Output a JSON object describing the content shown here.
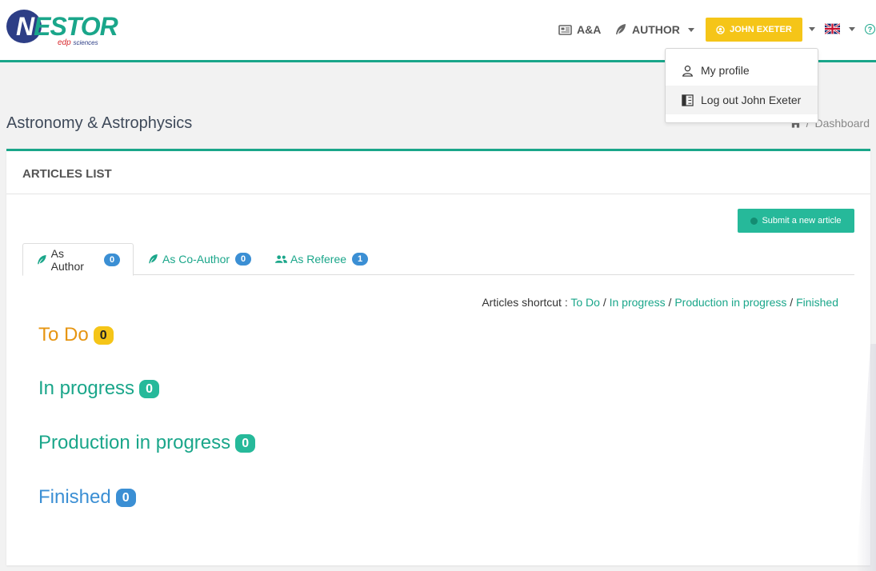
{
  "header": {
    "logo_main": "N",
    "logo_rest": "ESTOR",
    "logo_edp": "edp",
    "logo_sciences": "sciences",
    "journal_link": "A&A",
    "author_menu": "AUTHOR",
    "user_button": "JOHN EXETER"
  },
  "user_menu": {
    "items": [
      {
        "label": "My profile",
        "icon": "user-icon"
      },
      {
        "label": "Log out John Exeter",
        "icon": "logout-icon"
      }
    ]
  },
  "page": {
    "title": "Astronomy & Astrophysics",
    "breadcrumb_separator": "/",
    "breadcrumb_current": "Dashboard"
  },
  "panel": {
    "title": "ARTICLES LIST",
    "submit_label": "Submit a new article",
    "tabs": [
      {
        "label": "As Author",
        "count": "0",
        "active": true
      },
      {
        "label": "As Co-Author",
        "count": "0",
        "active": false
      },
      {
        "label": "As Referee",
        "count": "1",
        "active": false
      }
    ],
    "shortcut": {
      "prefix": "Articles shortcut : ",
      "links": [
        "To Do",
        "In progress",
        "Production in progress",
        "Finished"
      ],
      "separator": " / "
    },
    "sections": [
      {
        "label": "To Do",
        "count": "0",
        "color": "#e69512"
      },
      {
        "label": "In progress",
        "count": "0",
        "color": "#1aa68a"
      },
      {
        "label": "Production in progress",
        "count": "0",
        "color": "#1aa68a"
      },
      {
        "label": "Finished",
        "count": "0",
        "color": "#3b8fd4"
      }
    ]
  },
  "colors": {
    "accent": "#1aa68a",
    "user_button": "#f5c518",
    "submit_button": "#26b99a",
    "badge_blue": "#3b8fd4"
  }
}
